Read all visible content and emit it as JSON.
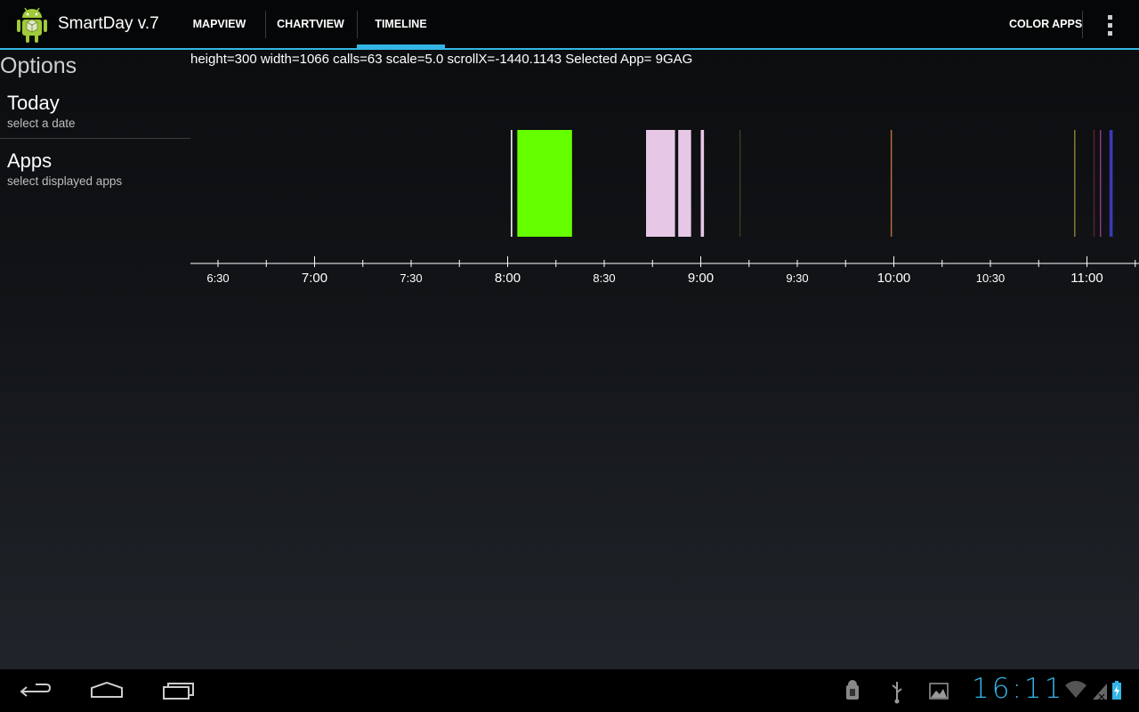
{
  "app": {
    "title": "SmartDay v.7",
    "icon": "android-robot-icon",
    "accent_color": "#33b5e5"
  },
  "tabs": [
    {
      "label": "MAPVIEW",
      "active": false
    },
    {
      "label": "CHARTVIEW",
      "active": false
    },
    {
      "label": "TIMELINE",
      "active": true
    }
  ],
  "actions": {
    "color_apps_label": "COLOR APPS",
    "overflow_icon": "overflow-menu-icon"
  },
  "options": {
    "header": "Options",
    "items": [
      {
        "title": "Today",
        "subtitle": "select a date"
      },
      {
        "title": "Apps",
        "subtitle": "select displayed apps"
      }
    ]
  },
  "timeline": {
    "info": "height=300 width=1066 calls=63 scale=5.0 scrollX=-1440.1143 Selected App= 9GAG",
    "major_ticks": [
      "6:30",
      "7:00",
      "7:30",
      "8:00",
      "8:30",
      "9:00",
      "9:30",
      "10:00",
      "10:30",
      "11:00"
    ],
    "events": [
      {
        "start": "8:01",
        "end": "8:01",
        "color": "#ffffff"
      },
      {
        "start": "8:03",
        "end": "8:20",
        "color": "#66ff00"
      },
      {
        "start": "8:43",
        "end": "8:52",
        "color": "#e6c8e6"
      },
      {
        "start": "8:53",
        "end": "8:57",
        "color": "#e6c8e6"
      },
      {
        "start": "9:00",
        "end": "9:01",
        "color": "#e6c8e6"
      },
      {
        "start": "9:12",
        "end": "9:12",
        "color": "#3a3a20"
      },
      {
        "start": "9:59",
        "end": "9:59",
        "color": "#b86a3a"
      },
      {
        "start": "10:56",
        "end": "10:56",
        "color": "#8a7a30"
      },
      {
        "start": "11:02",
        "end": "11:02",
        "color": "#5a2030"
      },
      {
        "start": "11:04",
        "end": "11:04",
        "color": "#8a3a8a"
      },
      {
        "start": "11:07",
        "end": "11:08",
        "color": "#3a3ab8"
      }
    ]
  },
  "navbar": {
    "back_icon": "back-icon",
    "home_icon": "home-icon",
    "recents_icon": "recent-apps-icon"
  },
  "status": {
    "time": "16:11",
    "icons": [
      "android-debug-icon",
      "usb-icon",
      "image-icon",
      "wifi-icon",
      "signal-icon",
      "battery-icon"
    ]
  }
}
